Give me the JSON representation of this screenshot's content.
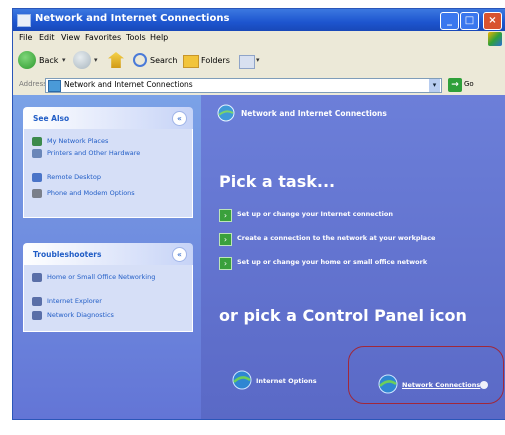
{
  "window": {
    "title": "Network and Internet Connections",
    "controls": {
      "minimize": "_",
      "maximize": "□",
      "close": "×"
    }
  },
  "menu": {
    "items": [
      "File",
      "Edit",
      "View",
      "Favorites",
      "Tools",
      "Help"
    ]
  },
  "toolbar": {
    "back_label": "Back",
    "search_label": "Search",
    "folders_label": "Folders"
  },
  "address": {
    "label": "Address",
    "value": "Network and Internet Connections",
    "go_label": "Go"
  },
  "see_also": {
    "title": "See Also",
    "toggle": "«",
    "items": [
      "My Network Places",
      "Printers and Other Hardware",
      "Remote Desktop",
      "Phone and Modem Options"
    ]
  },
  "troubleshooters": {
    "title": "Troubleshooters",
    "toggle": "«",
    "items": [
      "Home or Small Office Networking",
      "Internet Explorer",
      "Network Diagnostics"
    ]
  },
  "main": {
    "heading": "Network and Internet Connections",
    "pick_task": "Pick a task...",
    "tasks": [
      "Set up or change your Internet connection",
      "Create a connection to the network at your workplace",
      "Set up or change your home or small office network"
    ],
    "or_pick": "or pick a Control Panel icon",
    "control_panel_icons": [
      "Internet Options",
      "Network Connections"
    ]
  },
  "colors": {
    "title_bar": "#1d55cf",
    "left_pane": "#6f8ce0",
    "right_pane": "#6474d0",
    "link": "#215dc6",
    "highlight": "#a0283a"
  }
}
